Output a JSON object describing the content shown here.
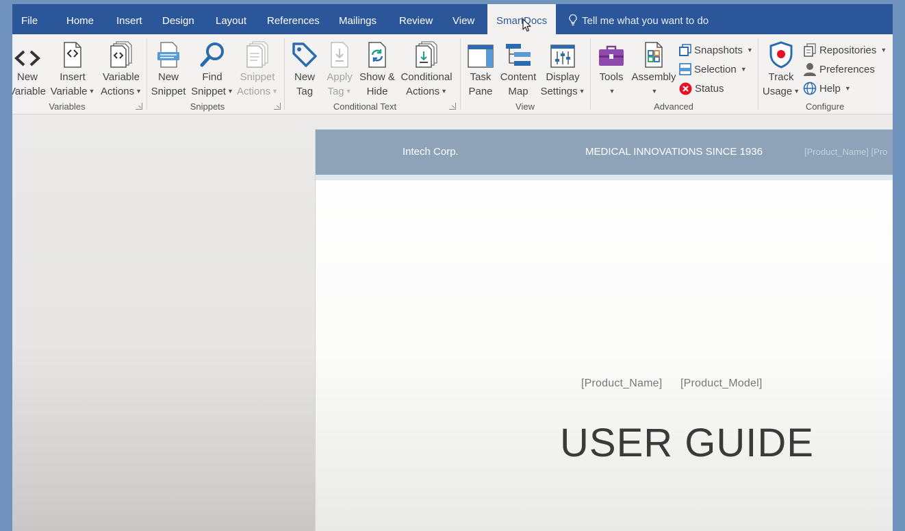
{
  "tabs": [
    {
      "label": "File"
    },
    {
      "label": "Home"
    },
    {
      "label": "Insert"
    },
    {
      "label": "Design"
    },
    {
      "label": "Layout"
    },
    {
      "label": "References"
    },
    {
      "label": "Mailings"
    },
    {
      "label": "Review"
    },
    {
      "label": "View"
    },
    {
      "label": "SmartDocs",
      "active": true
    }
  ],
  "tell_me": "Tell me what you want to do",
  "ribbon": {
    "variables": {
      "group_label": "Variables",
      "new_variable": [
        "New",
        "Variable"
      ],
      "insert_variable": [
        "Insert",
        "Variable"
      ],
      "variable_actions": [
        "Variable",
        "Actions"
      ]
    },
    "snippets": {
      "group_label": "Snippets",
      "new_snippet": [
        "New",
        "Snippet"
      ],
      "find_snippet": [
        "Find",
        "Snippet"
      ],
      "snippet_actions": [
        "Snippet",
        "Actions"
      ]
    },
    "conditional_text": {
      "group_label": "Conditional Text",
      "new_tag": [
        "New",
        "Tag"
      ],
      "apply_tag": [
        "Apply",
        "Tag"
      ],
      "show_hide": [
        "Show &",
        "Hide"
      ],
      "conditional_actions": [
        "Conditional",
        "Actions"
      ]
    },
    "view": {
      "group_label": "View",
      "task_pane": [
        "Task",
        "Pane"
      ],
      "content_map": [
        "Content",
        "Map"
      ],
      "display_settings": [
        "Display",
        "Settings"
      ]
    },
    "advanced": {
      "group_label": "Advanced",
      "tools": "Tools",
      "assembly": "Assembly",
      "snapshots": "Snapshots",
      "selection": "Selection",
      "status": "Status"
    },
    "configure": {
      "group_label": "Configure",
      "track_usage": [
        "Track",
        "Usage"
      ],
      "repositories": "Repositories",
      "preferences": "Preferences",
      "help": "Help"
    }
  },
  "document": {
    "header_company": "Intech Corp.",
    "header_tagline": "MEDICAL INNOVATIONS SINCE 1936",
    "header_fields": "[Product_Name] [Pro",
    "product_name": "[Product_Name]",
    "product_model": "[Product_Model]",
    "title": "USER GUIDE"
  },
  "colors": {
    "tab_bar": "#2b579a",
    "ribbon": "#f3f2f1",
    "page_header": "#8ea3b8",
    "accent_red": "#e81123"
  }
}
